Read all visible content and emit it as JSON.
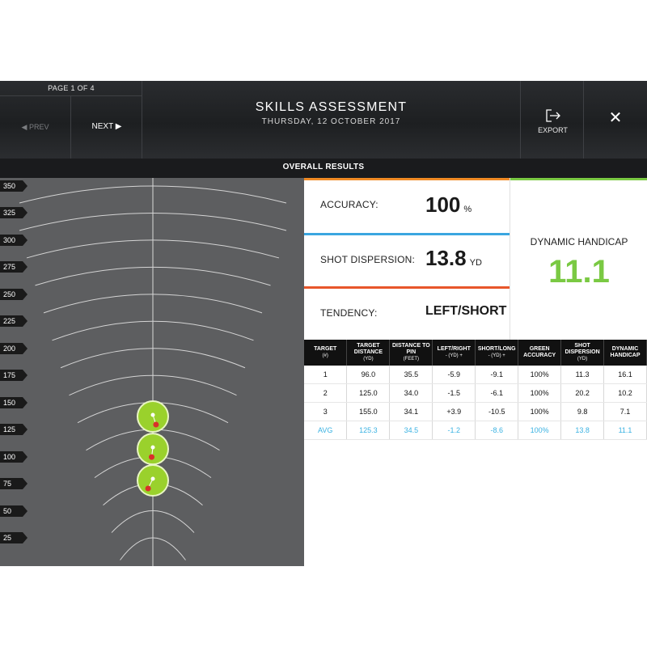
{
  "header": {
    "page_label": "PAGE 1 OF 4",
    "prev_label": "◀ PREV",
    "next_label": "NEXT ▶",
    "title": "SKILLS ASSESSMENT",
    "date": "THURSDAY, 12 OCTOBER 2017",
    "export_label": "EXPORT",
    "close_label": "✕"
  },
  "section_title": "OVERALL RESULTS",
  "range_view": {
    "distance_labels": [
      "350",
      "325",
      "300",
      "275",
      "250",
      "225",
      "200",
      "175",
      "150",
      "125",
      "100",
      "75",
      "50",
      "25"
    ],
    "targets": [
      {
        "target": 3,
        "distance": 155,
        "shot_offset_yd": 3.9
      },
      {
        "target": 2,
        "distance": 125,
        "shot_offset_yd": -1.5
      },
      {
        "target": 1,
        "distance": 96,
        "shot_offset_yd": -5.9
      }
    ]
  },
  "stats": {
    "accuracy_label": "ACCURACY:",
    "accuracy_value": "100",
    "accuracy_unit": "%",
    "dispersion_label": "SHOT DISPERSION:",
    "dispersion_value": "13.8",
    "dispersion_unit": "YD",
    "tendency_label": "TENDENCY:",
    "tendency_value": "LEFT/SHORT",
    "handicap_label": "DYNAMIC HANDICAP",
    "handicap_value": "11.1"
  },
  "colors": {
    "accuracy_stripe": "#f08a24",
    "dispersion_stripe": "#3aa6e0",
    "tendency_stripe": "#e8562a",
    "handicap_stripe": "#7ac943",
    "target_green": "#9ad12c",
    "avg_blue": "#3ab2e2"
  },
  "table": {
    "headers": [
      {
        "main": "TARGET",
        "sub": "(#)"
      },
      {
        "main": "TARGET DISTANCE",
        "sub": "(YD)"
      },
      {
        "main": "DISTANCE TO PIN",
        "sub": "(FEET)"
      },
      {
        "main": "LEFT/RIGHT",
        "sub": "- (YD) +"
      },
      {
        "main": "SHORT/LONG",
        "sub": "- (YD) +"
      },
      {
        "main": "GREEN ACCURACY",
        "sub": ""
      },
      {
        "main": "SHOT DISPERSION",
        "sub": "(YD)"
      },
      {
        "main": "DYNAMIC HANDICAP",
        "sub": ""
      }
    ],
    "rows": [
      [
        "1",
        "96.0",
        "35.5",
        "-5.9",
        "-9.1",
        "100%",
        "11.3",
        "16.1"
      ],
      [
        "2",
        "125.0",
        "34.0",
        "-1.5",
        "-6.1",
        "100%",
        "20.2",
        "10.2"
      ],
      [
        "3",
        "155.0",
        "34.1",
        "+3.9",
        "-10.5",
        "100%",
        "9.8",
        "7.1"
      ],
      [
        "AVG",
        "125.3",
        "34.5",
        "-1.2",
        "-8.6",
        "100%",
        "13.8",
        "11.1"
      ]
    ]
  }
}
